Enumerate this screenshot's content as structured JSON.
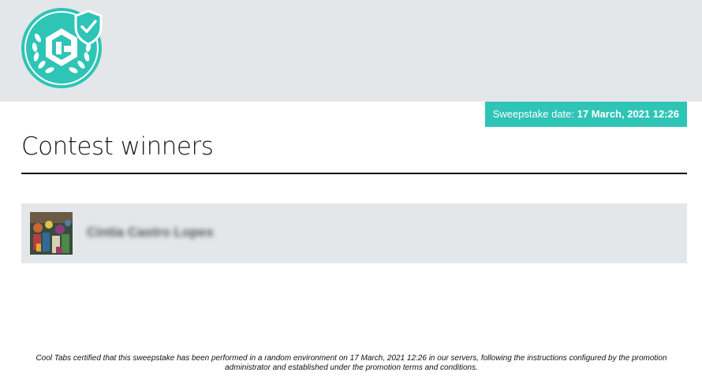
{
  "header": {
    "logo_icon": "cool-tabs-certified-badge-icon",
    "brand_color": "#2ec4b6"
  },
  "sweepstake": {
    "date_label": "Sweepstake date: ",
    "date_value": "17 March, 2021 12:26"
  },
  "main": {
    "title": "Contest winners",
    "winners": [
      {
        "name": "Cintia Castro Lopes",
        "avatar_icon": "user-photo"
      }
    ]
  },
  "footer": {
    "certification_text": "Cool Tabs certified that this sweepstake has been performed in a random environment on 17 March, 2021 12:26 in our servers, following the instructions configured by the promotion administrator and established under the promotion terms and conditions."
  }
}
